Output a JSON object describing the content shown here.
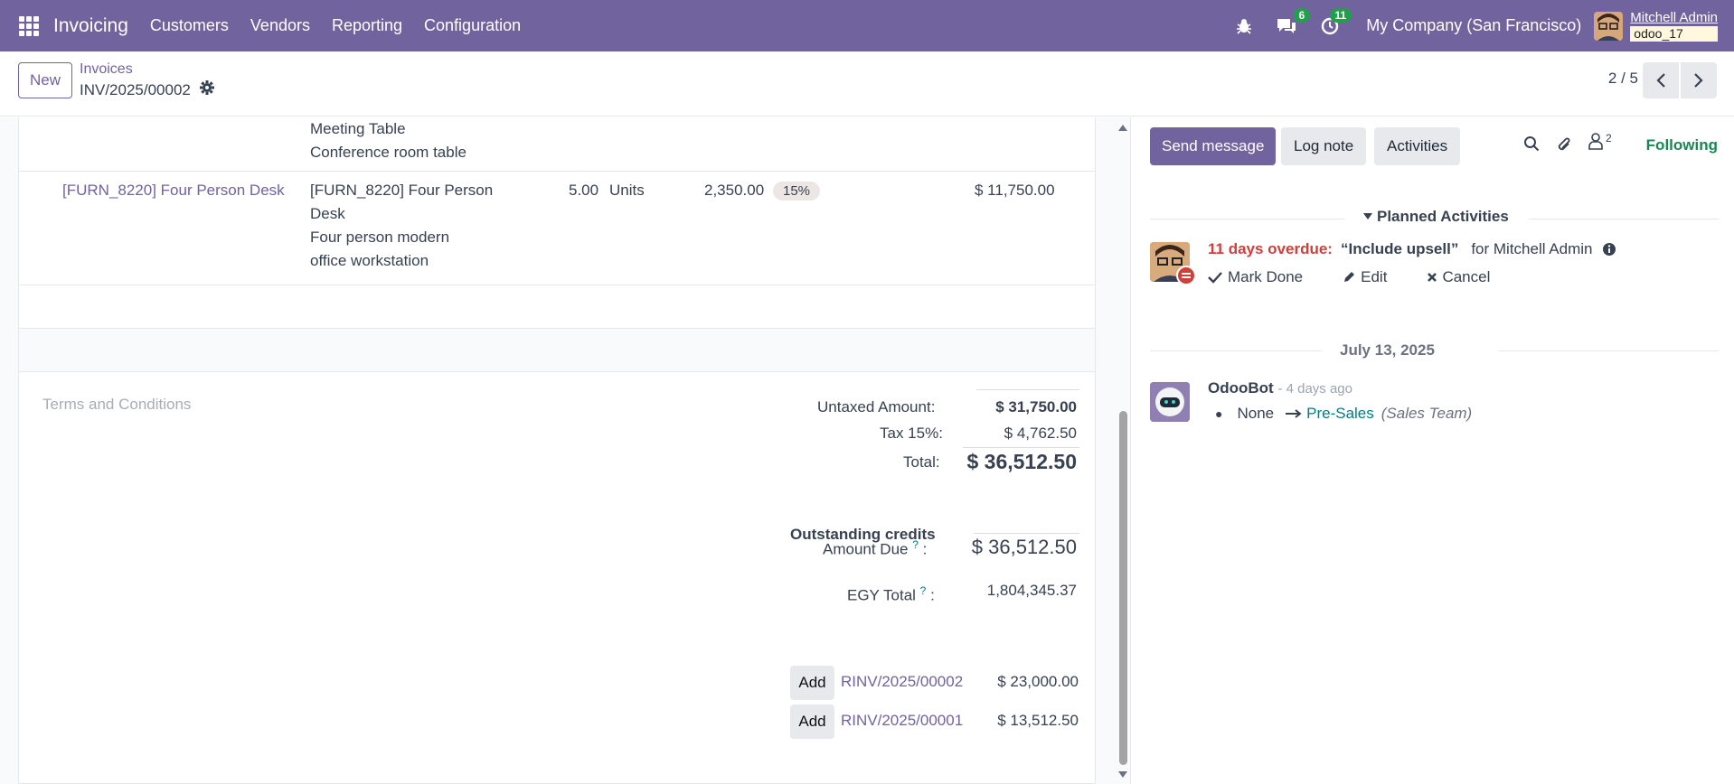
{
  "navbar": {
    "app_name": "Invoicing",
    "menu": [
      "Customers",
      "Vendors",
      "Reporting",
      "Configuration"
    ],
    "messages_badge": "6",
    "activities_badge": "11",
    "company": "My Company (San Francisco)",
    "user_name": "Mitchell Admin",
    "db_name": "odoo_17",
    "bg_color": "#71639e"
  },
  "control": {
    "new_label": "New",
    "breadcrumb": "Invoices",
    "record_name": "INV/2025/00002",
    "pager": "2 / 5"
  },
  "lines": {
    "prev_desc_1": "Meeting Table",
    "prev_desc_2": "Conference room table",
    "product": "[FURN_8220] Four Person Desk",
    "label_1": "[FURN_8220] Four Person",
    "label_2": "Desk",
    "label_3": "Four person modern",
    "label_4": "office workstation",
    "quantity": "5.00",
    "uom": "Units",
    "price": "2,350.00",
    "tax": "15%",
    "subtotal": "$ 11,750.00"
  },
  "terms_placeholder": "Terms and Conditions",
  "totals": {
    "untaxed_label": "Untaxed Amount:",
    "untaxed_value": "$ 31,750.00",
    "tax_label": "Tax 15%:",
    "tax_value": "$ 4,762.50",
    "total_label": "Total:",
    "total_value": "$ 36,512.50",
    "due_label": "Amount Due",
    "due_value": "$ 36,512.50",
    "egy_label": "EGY Total",
    "egy_value": "1,804,345.37",
    "help_mark": "?",
    "colon": ":"
  },
  "outstanding": {
    "title": "Outstanding credits",
    "add_label": "Add",
    "items": [
      {
        "ref": "RINV/2025/00002",
        "amount": "$ 23,000.00"
      },
      {
        "ref": "RINV/2025/00001",
        "amount": "$ 13,512.50"
      }
    ]
  },
  "chatter": {
    "send_message": "Send message",
    "log_note": "Log note",
    "activities": "Activities",
    "followers_count": "2",
    "following": "Following",
    "planned_title": "Planned Activities",
    "overdue": "11 days overdue:",
    "activity_summary": "“Include upsell”",
    "for_user": "for Mitchell Admin",
    "mark_done": "Mark Done",
    "edit": "Edit",
    "cancel": "Cancel",
    "date_separator": "July 13, 2025",
    "author": "OdooBot",
    "time": "- 4 days ago",
    "old_value": "None",
    "new_value": "Pre-Sales",
    "field_name": "(Sales Team)"
  }
}
